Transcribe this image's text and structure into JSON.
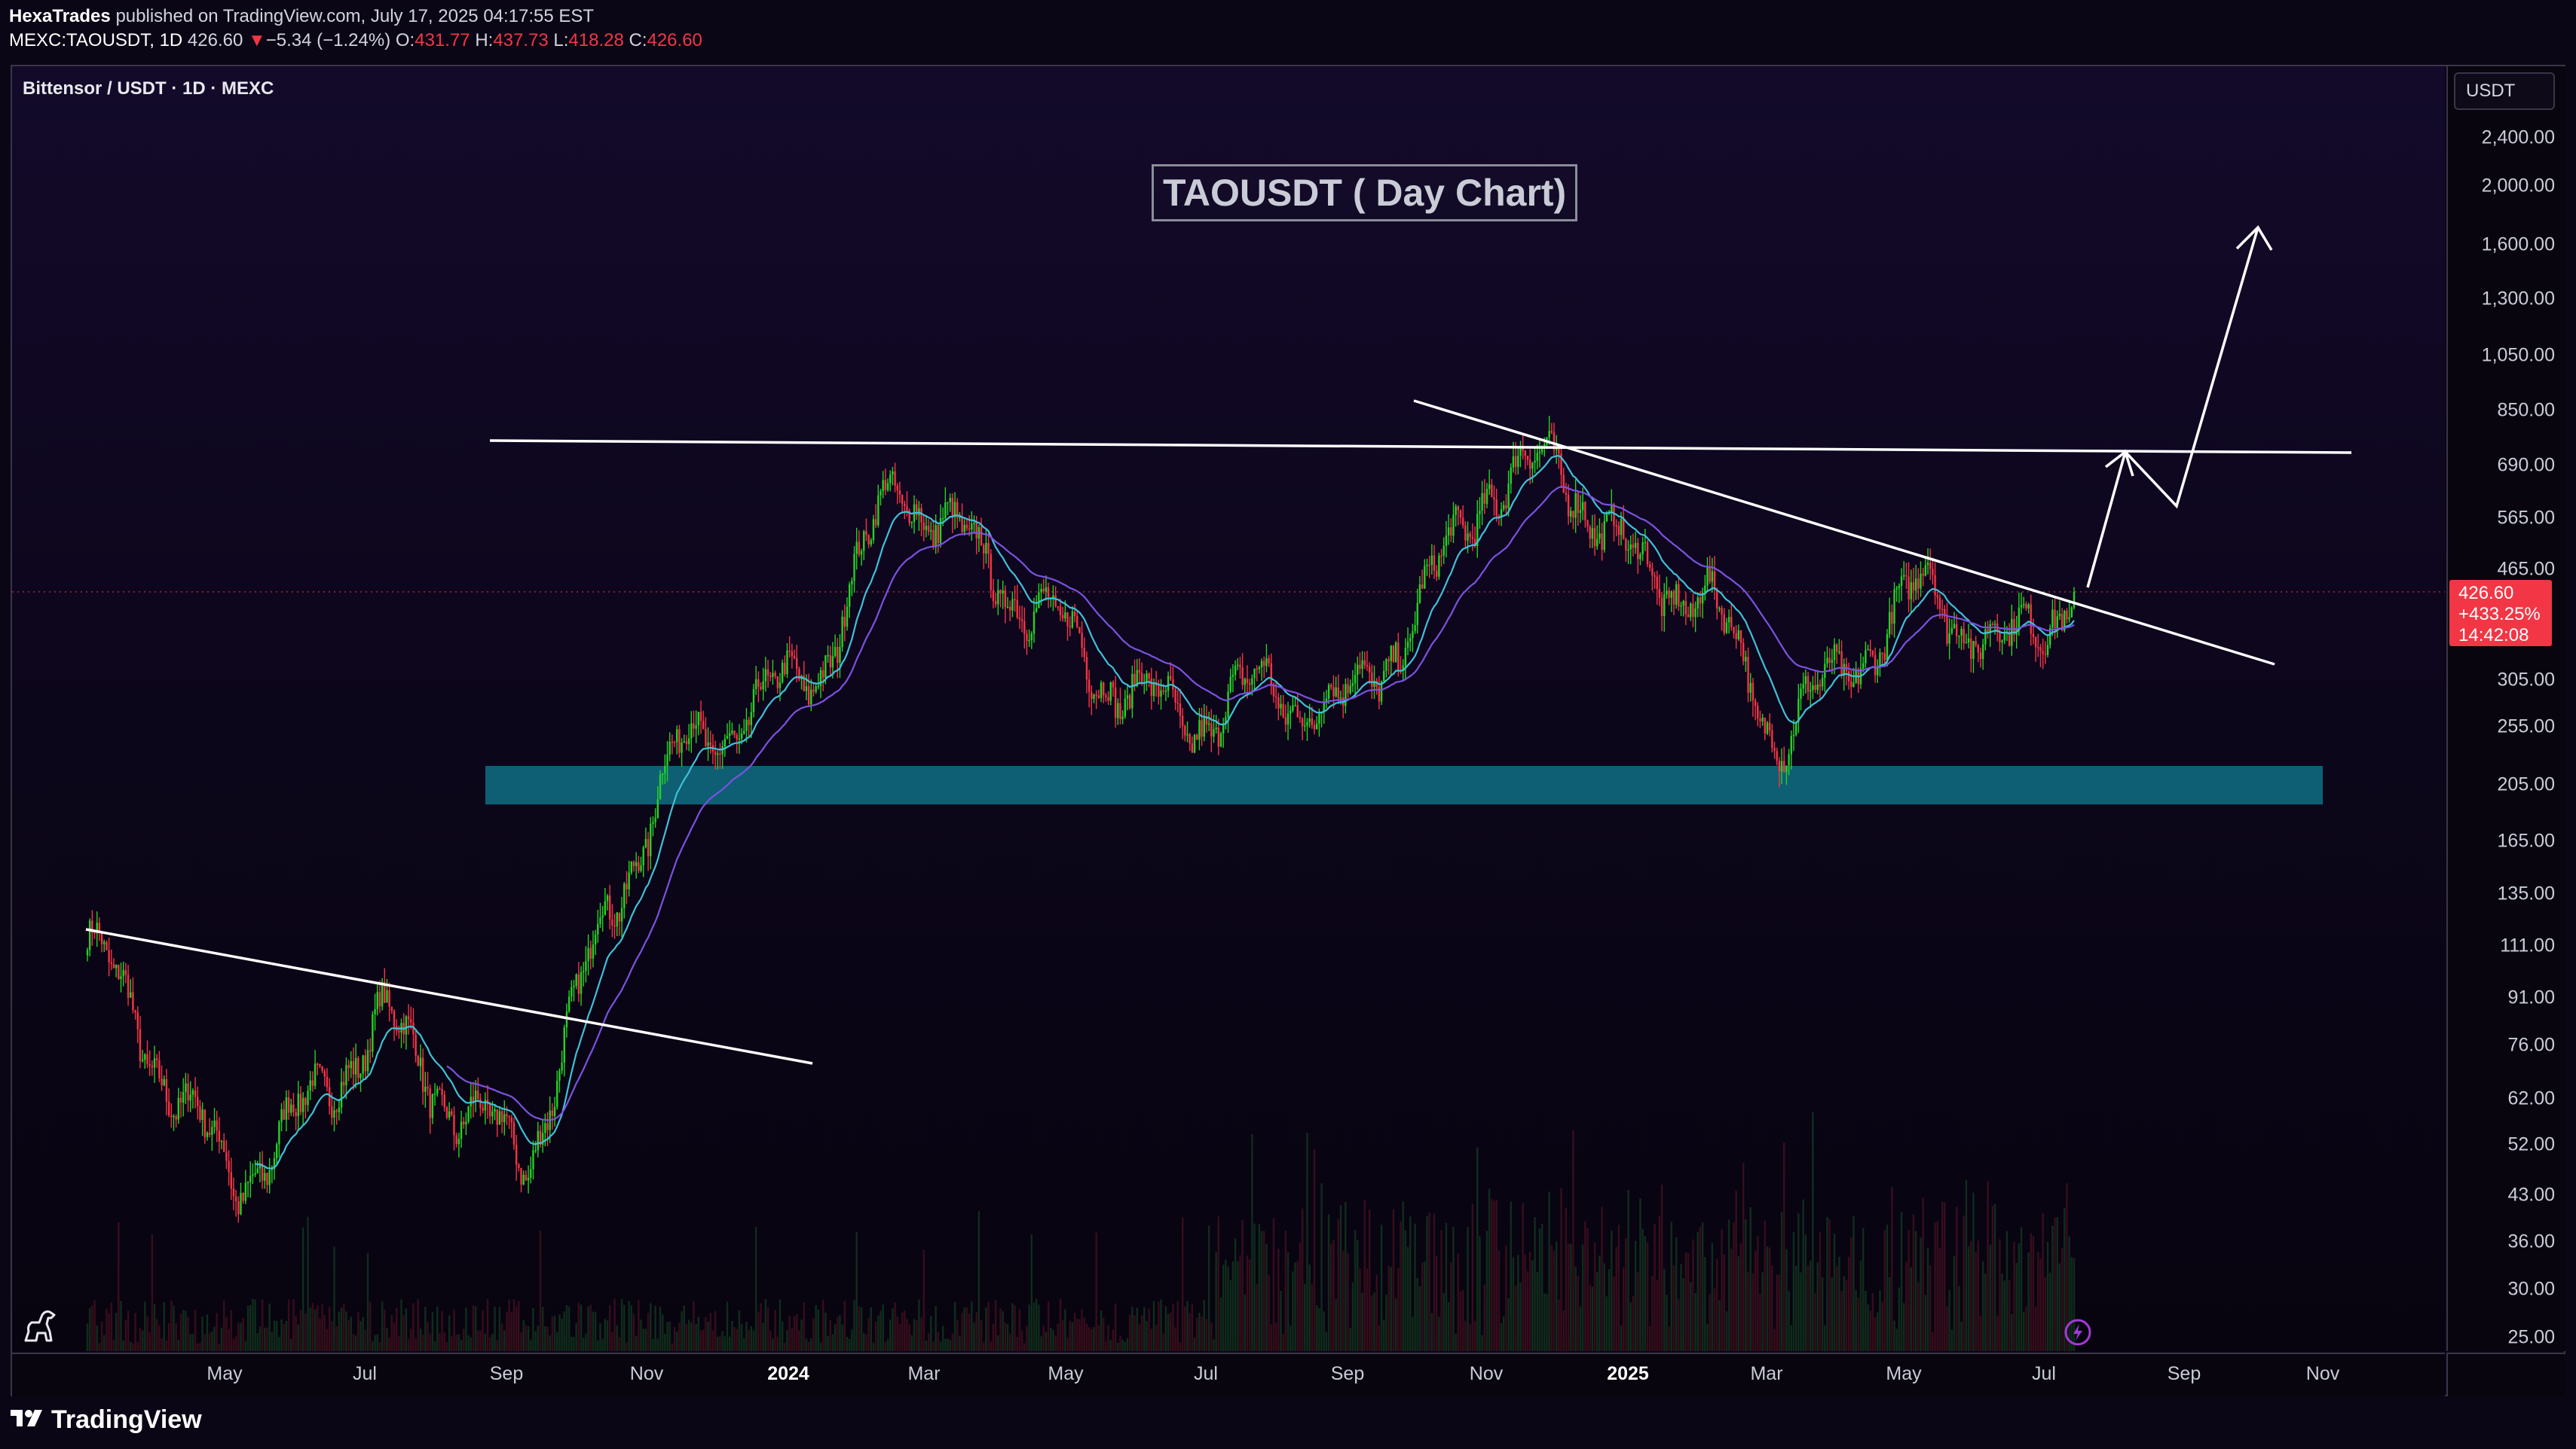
{
  "header": {
    "author": "HexaTrades",
    "published_text": "published on TradingView.com, July 17, 2025 04:17:55 EST",
    "symbol": "MEXC:TAOUSDT, 1D",
    "last_price": "426.60",
    "change_arrow": "▼",
    "change": "−5.34 (−1.24%)",
    "open_label": "O:",
    "open": "431.77",
    "high_label": "H:",
    "high": "437.73",
    "low_label": "L:",
    "low": "418.28",
    "close_label": "C:",
    "close": "426.60"
  },
  "chart": {
    "symbol_title": "Bittensor / USDT · 1D · MEXC",
    "currency_button": "USDT",
    "annotation": "TAOUSDT ( Day Chart)",
    "price_box": {
      "price": "426.60",
      "change_pct": "+433.25%",
      "countdown": "14:42:08"
    },
    "colors": {
      "up": "#26d126",
      "down": "#f23645",
      "ema_fast": "#3fc1d8",
      "ema_slow": "#7b52e0",
      "support_zone": "#0e5f73",
      "lines": "#ffffff"
    }
  },
  "price_axis_labels": [
    "2,400.00",
    "2,000.00",
    "1,600.00",
    "1,300.00",
    "1,050.00",
    "850.00",
    "690.00",
    "565.00",
    "465.00",
    "305.00",
    "255.00",
    "205.00",
    "165.00",
    "135.00",
    "111.00",
    "91.00",
    "76.00",
    "62.00",
    "52.00",
    "43.00",
    "36.00",
    "30.00",
    "25.00"
  ],
  "time_axis_labels": [
    {
      "text": "May",
      "bold": false
    },
    {
      "text": "Jul",
      "bold": false
    },
    {
      "text": "Sep",
      "bold": false
    },
    {
      "text": "Nov",
      "bold": false
    },
    {
      "text": "2024",
      "bold": true
    },
    {
      "text": "Mar",
      "bold": false
    },
    {
      "text": "May",
      "bold": false
    },
    {
      "text": "Jul",
      "bold": false
    },
    {
      "text": "Sep",
      "bold": false
    },
    {
      "text": "Nov",
      "bold": false
    },
    {
      "text": "2025",
      "bold": true
    },
    {
      "text": "Mar",
      "bold": false
    },
    {
      "text": "May",
      "bold": false
    },
    {
      "text": "Jul",
      "bold": false
    },
    {
      "text": "Sep",
      "bold": false
    },
    {
      "text": "Nov",
      "bold": false
    }
  ],
  "chart_data": {
    "type": "candlestick",
    "scale": "log",
    "ylim": [
      25,
      2600
    ],
    "x": [
      "2023-04",
      "2023-05",
      "2023-06",
      "2023-07",
      "2023-08",
      "2023-09",
      "2023-10",
      "2023-11",
      "2023-12",
      "2024-01",
      "2024-02",
      "2024-03",
      "2024-04",
      "2024-05",
      "2024-06",
      "2024-07",
      "2024-08",
      "2024-09",
      "2024-10",
      "2024-11",
      "2024-12",
      "2025-01",
      "2025-02",
      "2025-03",
      "2025-04",
      "2025-05",
      "2025-06",
      "2025-07"
    ],
    "close": [
      115,
      70,
      45,
      60,
      85,
      60,
      50,
      120,
      230,
      270,
      330,
      660,
      500,
      390,
      300,
      260,
      300,
      270,
      380,
      640,
      700,
      470,
      420,
      245,
      330,
      440,
      340,
      426.6
    ],
    "support_zone": [
      190,
      220
    ],
    "resistance": 720,
    "target_projection": 1750,
    "last_close": 426.6
  },
  "footer": {
    "brand": "TradingView"
  }
}
